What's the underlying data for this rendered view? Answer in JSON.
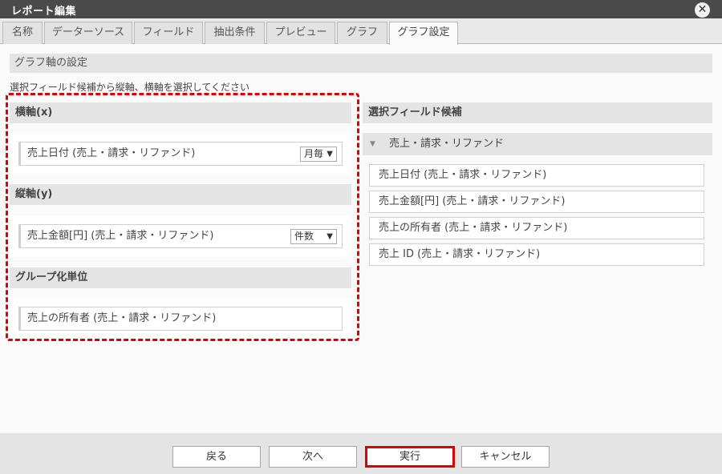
{
  "window": {
    "title": "レポート編集",
    "close_glyph": "✕"
  },
  "tabs": [
    "名称",
    "データーソース",
    "フィールド",
    "抽出条件",
    "プレビュー",
    "グラフ",
    "グラフ設定"
  ],
  "active_tab": "グラフ設定",
  "section_title": "グラフ軸の設定",
  "instruction": "選択フィールド候補から縦軸、横軸を選択してください",
  "x_axis": {
    "label": "横軸(x)",
    "field": "売上日付 (売上・請求・リファンド)",
    "select": "月毎"
  },
  "y_axis": {
    "label": "縦軸(y)",
    "field": "売上金額[円] (売上・請求・リファンド)",
    "select": "件数"
  },
  "group": {
    "label": "グループ化単位",
    "field": "売上の所有者 (売上・請求・リファンド)"
  },
  "candidates": {
    "title": "選択フィールド候補",
    "group_label": "売上・請求・リファンド",
    "items": [
      "売上日付 (売上・請求・リファンド)",
      "売上金額[円] (売上・請求・リファンド)",
      "売上の所有者 (売上・請求・リファンド)",
      "売上 ID (売上・請求・リファンド)"
    ]
  },
  "buttons": {
    "back": "戻る",
    "next": "次へ",
    "run": "実行",
    "cancel": "キャンセル"
  },
  "colors": {
    "highlight": "#e00000",
    "titlebar": "#4a4a4a",
    "panel_header": "#e4e4e4"
  },
  "icons": {
    "select_arrow": "▼",
    "group_collapse": "▼"
  }
}
